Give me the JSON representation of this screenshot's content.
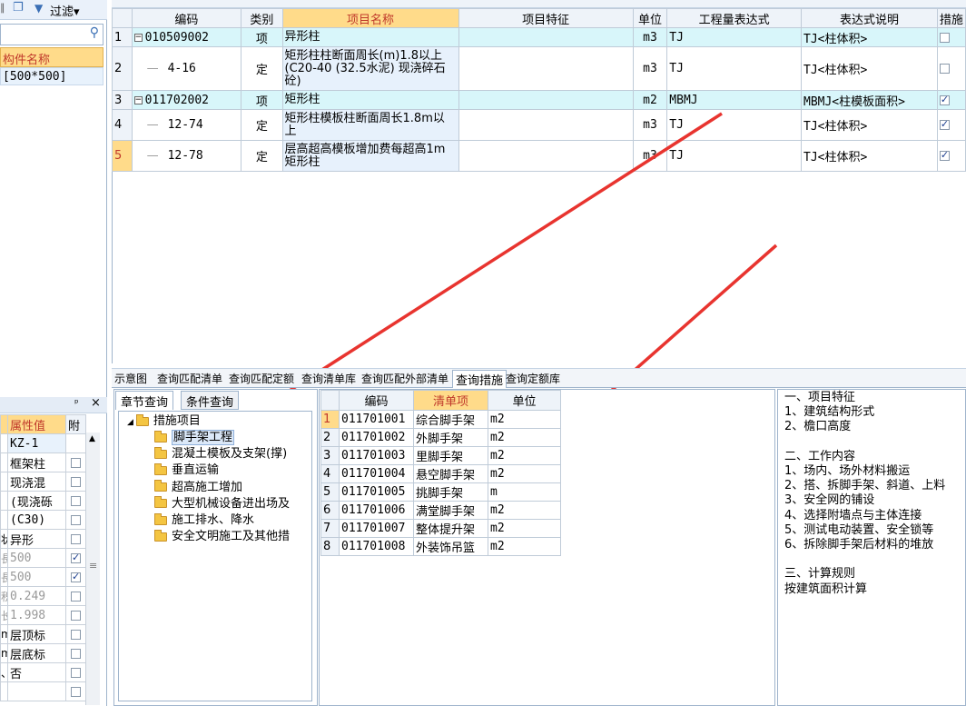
{
  "left_toolbar": {
    "filter_label": "过滤"
  },
  "component_list": {
    "header": "构件名称",
    "rows": [
      "[500*500]"
    ]
  },
  "properties": {
    "pin": "ᵖ",
    "col_value": "属性值",
    "col_attach": "附",
    "rows": [
      {
        "label": "",
        "value": "KZ-1",
        "checked": null,
        "grey": false
      },
      {
        "label": "",
        "value": "框架柱",
        "checked": false,
        "grey": false
      },
      {
        "label": "",
        "value": "现浇混",
        "checked": false,
        "grey": false
      },
      {
        "label": "",
        "value": "(现浇砾",
        "checked": false,
        "grey": false
      },
      {
        "label": "",
        "value": "(C30)",
        "checked": false,
        "grey": false
      },
      {
        "label": "状",
        "value": "异形",
        "checked": false,
        "grey": false
      },
      {
        "label": "長",
        "value": "500",
        "checked": true,
        "grey": true
      },
      {
        "label": "長",
        "value": "500",
        "checked": true,
        "grey": true
      },
      {
        "label": "积",
        "value": "0.249",
        "checked": false,
        "grey": true
      },
      {
        "label": "长",
        "value": "1.998",
        "checked": false,
        "grey": true
      },
      {
        "label": "m",
        "value": "层顶标",
        "checked": false,
        "grey": false
      },
      {
        "label": "m",
        "value": "层底标",
        "checked": false,
        "grey": false
      },
      {
        "label": "、",
        "value": "否",
        "checked": false,
        "grey": false
      },
      {
        "label": "",
        "value": "",
        "checked": false,
        "grey": false
      }
    ]
  },
  "main_grid": {
    "columns": [
      "编码",
      "类别",
      "项目名称",
      "项目特征",
      "单位",
      "工程量表达式",
      "表达式说明",
      "措施"
    ],
    "rows": [
      {
        "n": "1",
        "code": "010509002",
        "type": "项",
        "name": "异形柱",
        "feature": "",
        "unit": "m3",
        "expr": "TJ",
        "desc": "TJ<柱体积>",
        "qd": true
      },
      {
        "n": "2",
        "code": "4-16",
        "type": "定",
        "name": "矩形柱柱断面周长(m)1.8以上(C20-40 (32.5水泥) 现浇碎石砼)",
        "feature": "",
        "unit": "m3",
        "expr": "TJ",
        "desc": "TJ<柱体积>",
        "qd": false
      },
      {
        "n": "3",
        "code": "011702002",
        "type": "项",
        "name": "矩形柱",
        "feature": "",
        "unit": "m2",
        "expr": "MBMJ",
        "desc": "MBMJ<柱模板面积>",
        "qd": true
      },
      {
        "n": "4",
        "code": "12-74",
        "type": "定",
        "name": "矩形柱模板柱断面周长1.8m以上",
        "feature": "",
        "unit": "m3",
        "expr": "TJ",
        "desc": "TJ<柱体积>",
        "qd": false
      },
      {
        "n": "5",
        "code": "12-78",
        "type": "定",
        "name": "层高超高模板增加费每超高1m 矩形柱",
        "feature": "",
        "unit": "m3",
        "expr": "TJ",
        "desc": "TJ<柱体积>",
        "qd": false
      }
    ]
  },
  "bottom_tabs": [
    "示意图",
    "查询匹配清单",
    "查询匹配定额",
    "查询清单库",
    "查询匹配外部清单",
    "查询措施",
    "查询定额库"
  ],
  "sub_tabs": [
    "章节查询",
    "条件查询"
  ],
  "tree": {
    "root": "措施项目",
    "children": [
      "脚手架工程",
      "混凝土模板及支架(撑)",
      "垂直运输",
      "超高施工增加",
      "大型机械设备进出场及",
      "施工排水、降水",
      "安全文明施工及其他措"
    ]
  },
  "list_grid": {
    "columns": [
      "编码",
      "清单项",
      "单位"
    ],
    "rows": [
      {
        "n": "1",
        "code": "011701001",
        "name": "综合脚手架",
        "unit": "m2"
      },
      {
        "n": "2",
        "code": "011701002",
        "name": "外脚手架",
        "unit": "m2"
      },
      {
        "n": "3",
        "code": "011701003",
        "name": "里脚手架",
        "unit": "m2"
      },
      {
        "n": "4",
        "code": "011701004",
        "name": "悬空脚手架",
        "unit": "m2"
      },
      {
        "n": "5",
        "code": "011701005",
        "name": "挑脚手架",
        "unit": "m"
      },
      {
        "n": "6",
        "code": "011701006",
        "name": "满堂脚手架",
        "unit": "m2"
      },
      {
        "n": "7",
        "code": "011701007",
        "name": "整体提升架",
        "unit": "m2"
      },
      {
        "n": "8",
        "code": "011701008",
        "name": "外装饰吊篮",
        "unit": "m2"
      }
    ]
  },
  "description": {
    "lines": [
      "一、项目特征",
      "1、建筑结构形式",
      "2、檐口高度",
      "",
      "二、工作内容",
      "1、场内、场外材料搬运",
      "2、搭、拆脚手架、斜道、上料",
      "3、安全网的铺设",
      "4、选择附墙点与主体连接",
      "5、测试电动装置、安全锁等",
      "6、拆除脚手架后材料的堆放",
      "",
      "三、计算规则",
      " 按建筑面积计算"
    ]
  },
  "colors": {
    "arrow": "#e8342f",
    "header_highlight": "#ffdb8a",
    "qd_row": "#d8f6fa"
  }
}
